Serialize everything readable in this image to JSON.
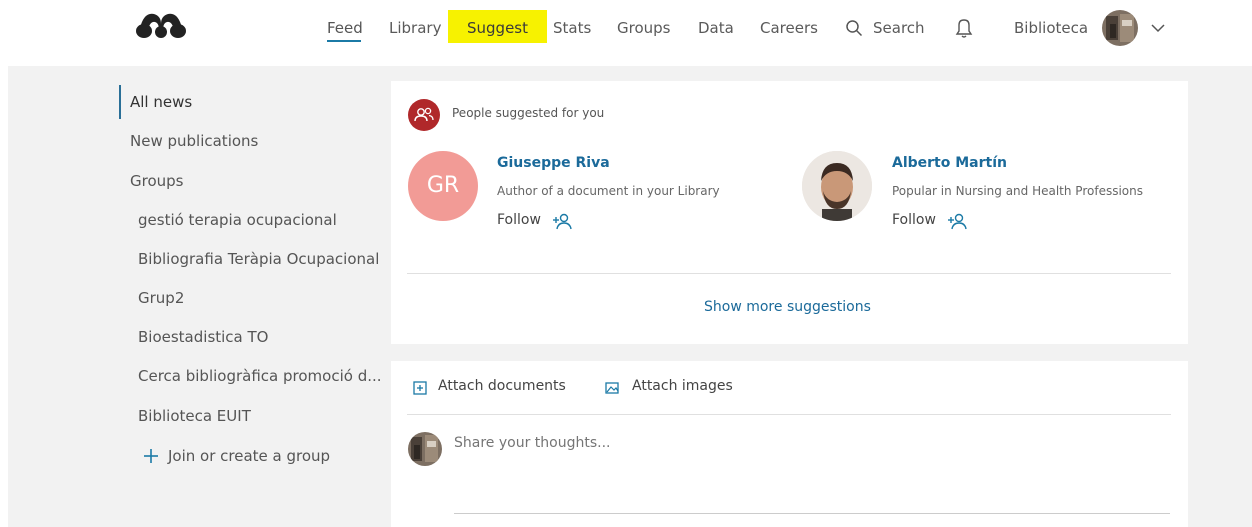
{
  "header": {
    "nav": {
      "feed": "Feed",
      "library": "Library",
      "suggest": "Suggest",
      "stats": "Stats",
      "groups": "Groups",
      "data": "Data",
      "careers": "Careers",
      "search": "Search",
      "user": "Biblioteca"
    },
    "highlight_color": "#f7f200",
    "accent_color": "#1b7aa6"
  },
  "sidebar": {
    "all_news": "All news",
    "new_publications": "New publications",
    "groups_heading": "Groups",
    "groups": [
      "gestió terapia ocupacional",
      "Bibliografia Teràpia Ocupacional",
      "Grup2",
      "Bioestadistica TO",
      "Cerca bibliogràfica promoció d...",
      "Biblioteca EUIT"
    ],
    "join_label": "Join or create a group"
  },
  "suggestions": {
    "heading": "People suggested for you",
    "people": [
      {
        "initials": "GR",
        "name": "Giuseppe Riva",
        "reason": "Author of a document in your Library",
        "follow": "Follow"
      },
      {
        "name": "Alberto Martín",
        "reason": "Popular in Nursing and Health Professions",
        "follow": "Follow"
      }
    ],
    "show_more": "Show more suggestions"
  },
  "composer": {
    "attach_documents": "Attach documents",
    "attach_images": "Attach images",
    "placeholder": "Share your thoughts..."
  }
}
